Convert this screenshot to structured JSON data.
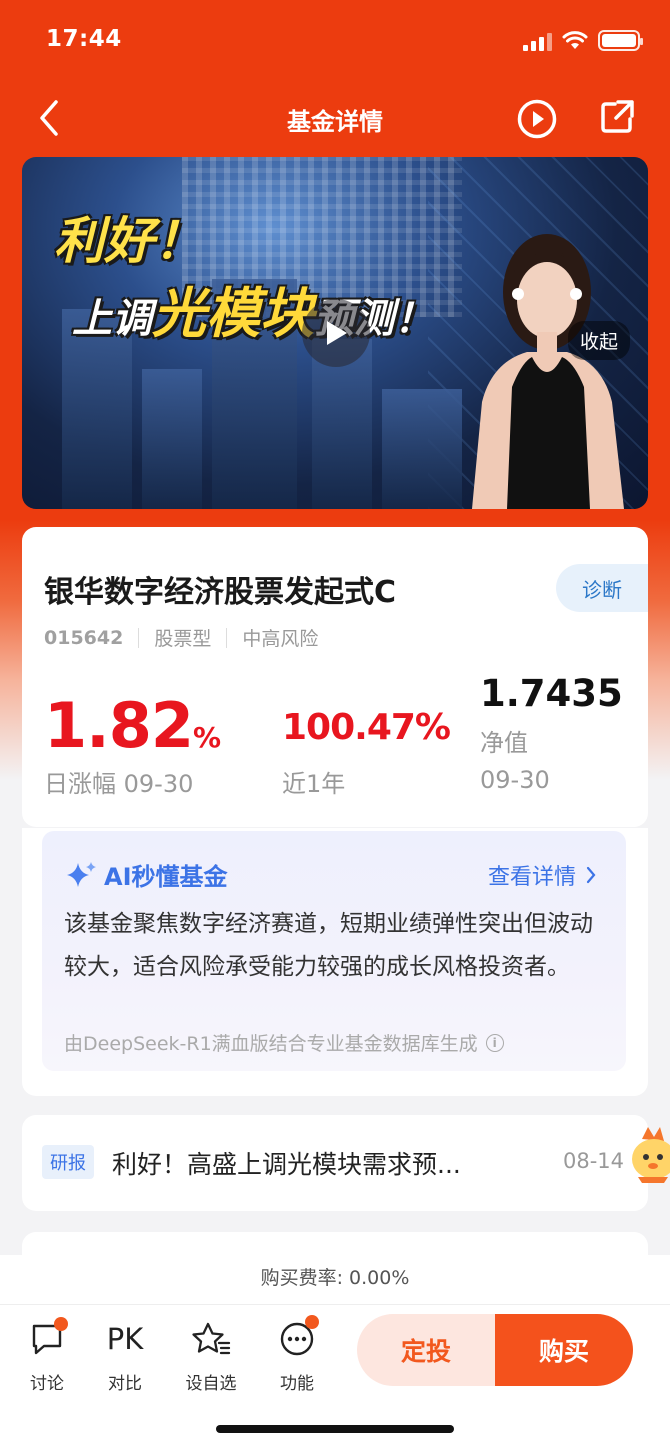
{
  "status_bar": {
    "time": "17:44"
  },
  "header": {
    "title": "基金详情"
  },
  "banner": {
    "headline1": "利好！",
    "headline2_pre": "上调",
    "headline2_hl": "光模块",
    "headline2_post": "预测！",
    "collapse_label": "收起"
  },
  "fund": {
    "name": "银华数字经济股票发起式C",
    "diagnose_label": "诊断",
    "code": "015642",
    "type": "股票型",
    "risk": "中高风险",
    "daily_change": "1.82",
    "daily_change_unit": "%",
    "daily_change_label": "日涨幅",
    "daily_change_date": "09-30",
    "year_return": "100.47%",
    "year_return_label": "近1年",
    "nav": "1.7435",
    "nav_label": "净值",
    "nav_date": "09-30",
    "up_color": "#e8161f"
  },
  "ai": {
    "title": "AI秒懂基金",
    "link_label": "查看详情",
    "text": "该基金聚焦数字经济赛道，短期业绩弹性突出但波动较大，适合风险承受能力较强的成长风格投资者。",
    "footer": "由DeepSeek-R1满血版结合专业基金数据库生成",
    "accent": "#3c73e6"
  },
  "news": {
    "tag": "研报",
    "title": "利好！高盛上调光模块需求预...",
    "date": "08-14"
  },
  "fee": {
    "text": "购买费率: 0.00%"
  },
  "toolbar": {
    "discuss": "讨论",
    "compare_icon_text": "PK",
    "compare": "对比",
    "watchlist": "设自选",
    "functions": "功能",
    "auto_invest": "定投",
    "buy": "购买",
    "brand_color": "#f4521c"
  }
}
